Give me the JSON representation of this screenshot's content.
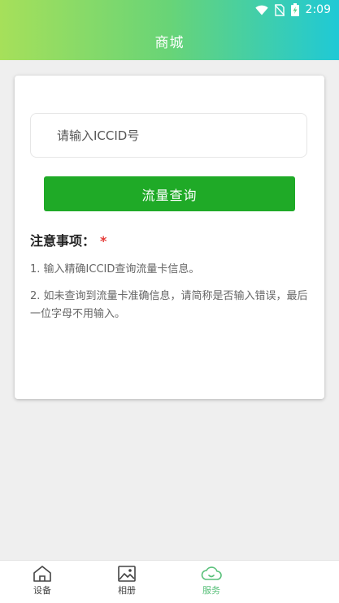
{
  "status": {
    "time": "2:09"
  },
  "header": {
    "title": "商城"
  },
  "form": {
    "iccid_placeholder": "请输入ICCID号",
    "query_button": "流量查询"
  },
  "notes": {
    "title": "注意事项：",
    "required_mark": "*",
    "items": [
      "1. 输入精确ICCID查询流量卡信息。",
      "2. 如未查询到流量卡准确信息，请简称是否输入错误，最后一位字母不用输入。"
    ]
  },
  "tabbar": {
    "items": [
      {
        "label": "设备",
        "icon": "home-icon"
      },
      {
        "label": "相册",
        "icon": "image-icon"
      },
      {
        "label": "服务",
        "icon": "cloud-icon",
        "active": true
      }
    ]
  },
  "colors": {
    "accent": "#1faa27",
    "tab_active": "#59c07a"
  }
}
